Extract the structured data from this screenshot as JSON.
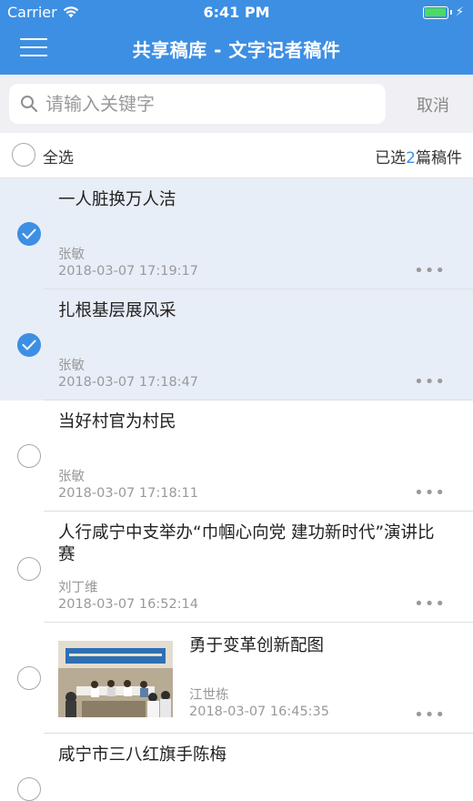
{
  "status": {
    "carrier": "Carrier",
    "time": "6:41 PM"
  },
  "nav": {
    "title": "共享稿库 - 文字记者稿件",
    "menu_icon": "hamburger-icon"
  },
  "search": {
    "placeholder": "请输入关键字",
    "value": "",
    "cancel": "取消"
  },
  "selection": {
    "select_all": "全选",
    "count_prefix": "已选",
    "count": "2",
    "count_suffix": "篇稿件"
  },
  "colors": {
    "accent": "#3d8fe3",
    "selected_row": "#e8eef7"
  },
  "articles": [
    {
      "title": "一人脏换万人洁",
      "author": "张敏",
      "date": "2018-03-07 17:19:17",
      "selected": true,
      "has_image": false
    },
    {
      "title": "扎根基层展风采",
      "author": "张敏",
      "date": "2018-03-07 17:18:47",
      "selected": true,
      "has_image": false
    },
    {
      "title": "当好村官为村民",
      "author": "张敏",
      "date": "2018-03-07 17:18:11",
      "selected": false,
      "has_image": false
    },
    {
      "title": "人行咸宁中支举办“巾帼心向党 建功新时代”演讲比赛",
      "author": "刘丁维",
      "date": "2018-03-07 16:52:14",
      "selected": false,
      "has_image": false
    },
    {
      "title": "勇于变革创新配图",
      "author": "江世栋",
      "date": "2018-03-07 16:45:35",
      "selected": false,
      "has_image": true
    },
    {
      "title": "咸宁市三八红旗手陈梅",
      "author": "",
      "date": "",
      "selected": false,
      "has_image": false
    }
  ],
  "more_label": "•••"
}
